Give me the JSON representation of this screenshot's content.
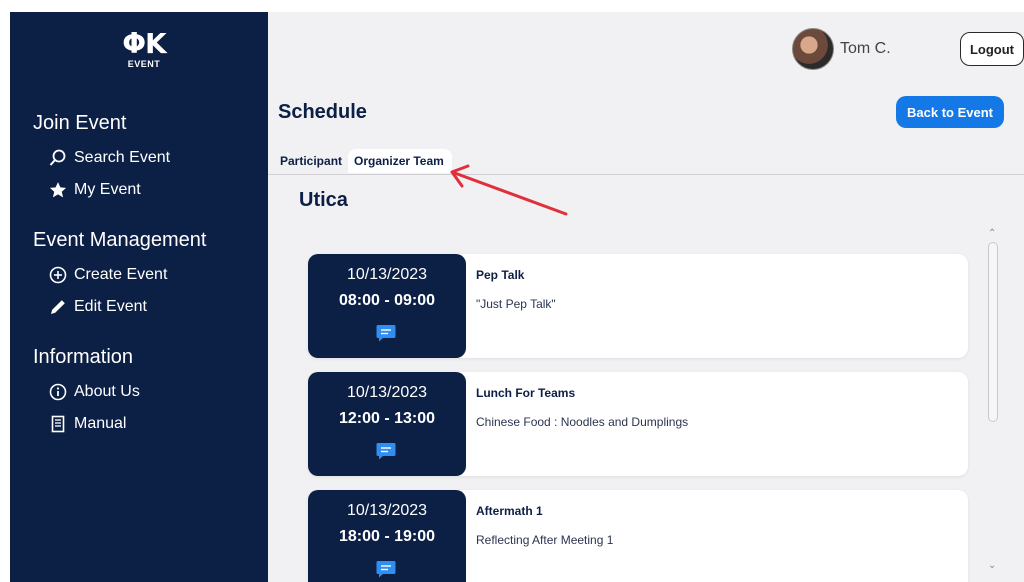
{
  "logo": {
    "mark": "ΦK",
    "sub": "EVENT"
  },
  "sidebar": {
    "sections": [
      {
        "title": "Join Event",
        "items": [
          {
            "label": "Search Event",
            "icon": "search-icon"
          },
          {
            "label": "My Event",
            "icon": "star-icon"
          }
        ]
      },
      {
        "title": "Event Management",
        "items": [
          {
            "label": "Create Event",
            "icon": "plus-circle-icon"
          },
          {
            "label": "Edit Event",
            "icon": "pencil-icon"
          }
        ]
      },
      {
        "title": "Information",
        "items": [
          {
            "label": "About Us",
            "icon": "info-icon"
          },
          {
            "label": "Manual",
            "icon": "book-icon"
          }
        ]
      }
    ]
  },
  "header": {
    "user_name": "Tom C.",
    "logout_label": "Logout"
  },
  "main": {
    "title": "Schedule",
    "back_label": "Back to Event",
    "tabs": [
      {
        "label": "Participant",
        "active": false
      },
      {
        "label": "Organizer Team",
        "active": true
      }
    ],
    "venue": "Utica",
    "events": [
      {
        "date": "10/13/2023",
        "time": "08:00 - 09:00",
        "title": "Pep Talk",
        "desc": "\"Just Pep Talk\""
      },
      {
        "date": "10/13/2023",
        "time": "12:00 - 13:00",
        "title": "Lunch For Teams",
        "desc": "Chinese Food : Noodles and Dumplings"
      },
      {
        "date": "10/13/2023",
        "time": "18:00 - 19:00",
        "title": "Aftermath 1",
        "desc": "Reflecting After Meeting 1"
      }
    ]
  },
  "colors": {
    "sidebar_bg": "#0c1f44",
    "accent": "#1479e6",
    "chat_icon": "#2f8ef0",
    "annotation_arrow": "#e0303a"
  }
}
